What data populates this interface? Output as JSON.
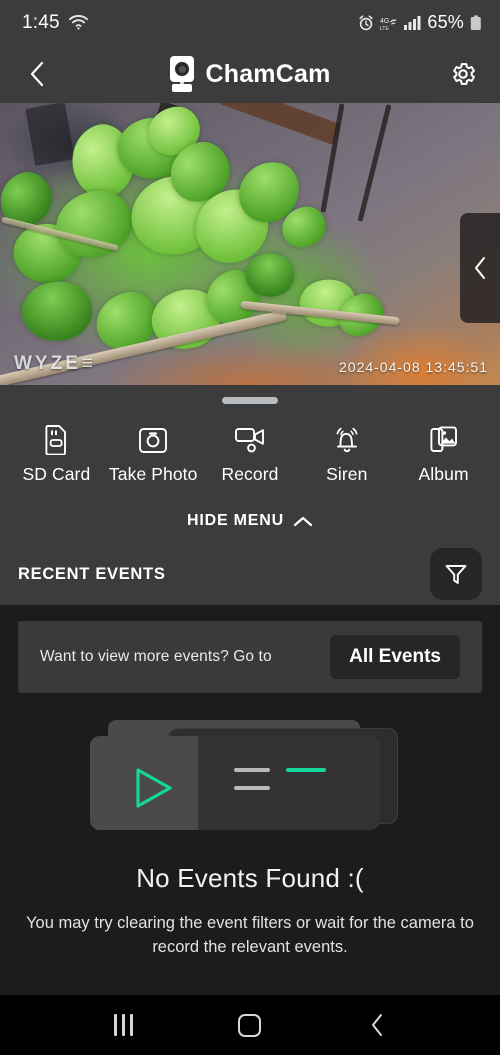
{
  "status_bar": {
    "time": "1:45",
    "battery_percent": "65%",
    "icons": [
      "wifi-icon",
      "alarm-icon",
      "lte-4g-icon",
      "signal-bars-icon",
      "battery-icon"
    ]
  },
  "header": {
    "title": "ChamCam",
    "back_icon": "chevron-left-icon",
    "camera_icon": "camera-device-icon",
    "settings_icon": "gear-icon"
  },
  "video": {
    "watermark": "WYZE",
    "timestamp": "2024-04-08 13:45:51",
    "side_panel_icon": "chevron-left-icon"
  },
  "actions": [
    {
      "label": "SD Card",
      "icon": "sd-card-icon"
    },
    {
      "label": "Take Photo",
      "icon": "camera-icon"
    },
    {
      "label": "Record",
      "icon": "video-record-icon"
    },
    {
      "label": "Siren",
      "icon": "siren-bell-icon"
    },
    {
      "label": "Album",
      "icon": "album-photos-icon"
    }
  ],
  "hide_menu": {
    "label": "HIDE MENU",
    "icon": "chevron-up-icon"
  },
  "recent_events": {
    "title": "RECENT EVENTS",
    "filter_icon": "funnel-filter-icon"
  },
  "banner": {
    "text": "Want to view more events? Go to",
    "button_label": "All Events"
  },
  "empty_state": {
    "illustration_icon": "play-card-illustration",
    "title": "No Events Found :(",
    "message": "You may try clearing the event filters or wait for the camera to record the relevant events."
  },
  "nav_bar": {
    "recents_icon": "recents-icon",
    "home_icon": "home-icon",
    "back_icon": "back-chevron-icon"
  },
  "colors": {
    "accent_green": "#15d79b",
    "panel_gray": "#3c3c3c",
    "page_background": "#1c1c1c",
    "button_dark": "#262626"
  }
}
